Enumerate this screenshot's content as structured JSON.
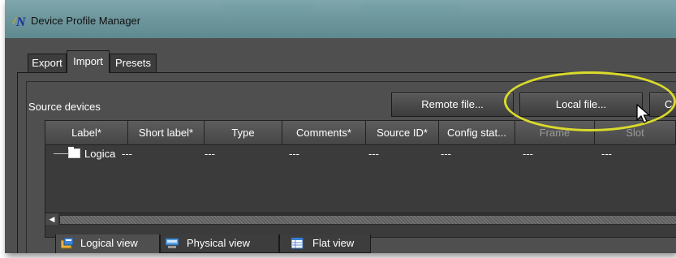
{
  "window": {
    "title": "Device Profile Manager",
    "icon": "app-logo-icon"
  },
  "tabs": [
    {
      "label": "Export",
      "active": false
    },
    {
      "label": "Import",
      "active": true
    },
    {
      "label": "Presets",
      "active": false
    }
  ],
  "source_devices": {
    "title": "Source devices",
    "buttons": {
      "remote": "Remote file...",
      "local": "Local file...",
      "clipped": "C"
    },
    "columns": [
      "Label*",
      "Short label*",
      "Type",
      "Comments*",
      "Source ID*",
      "Config stat...",
      "Frame",
      "Slot"
    ],
    "rows": [
      {
        "label": "Logica",
        "short_label": "---",
        "type": "---",
        "comments": "---",
        "source_id": "---",
        "config_status": "---",
        "frame": "---",
        "slot": "---"
      }
    ]
  },
  "view_tabs": [
    {
      "label": "Logical view",
      "icon": "logical-view-icon",
      "active": true
    },
    {
      "label": "Physical view",
      "icon": "physical-view-icon",
      "active": false
    },
    {
      "label": "Flat view",
      "icon": "flat-view-icon",
      "active": false
    }
  ],
  "colors": {
    "background": "#4f4f4f",
    "titlebar": "#6f989e",
    "highlight_ellipse": "#dada2c"
  }
}
